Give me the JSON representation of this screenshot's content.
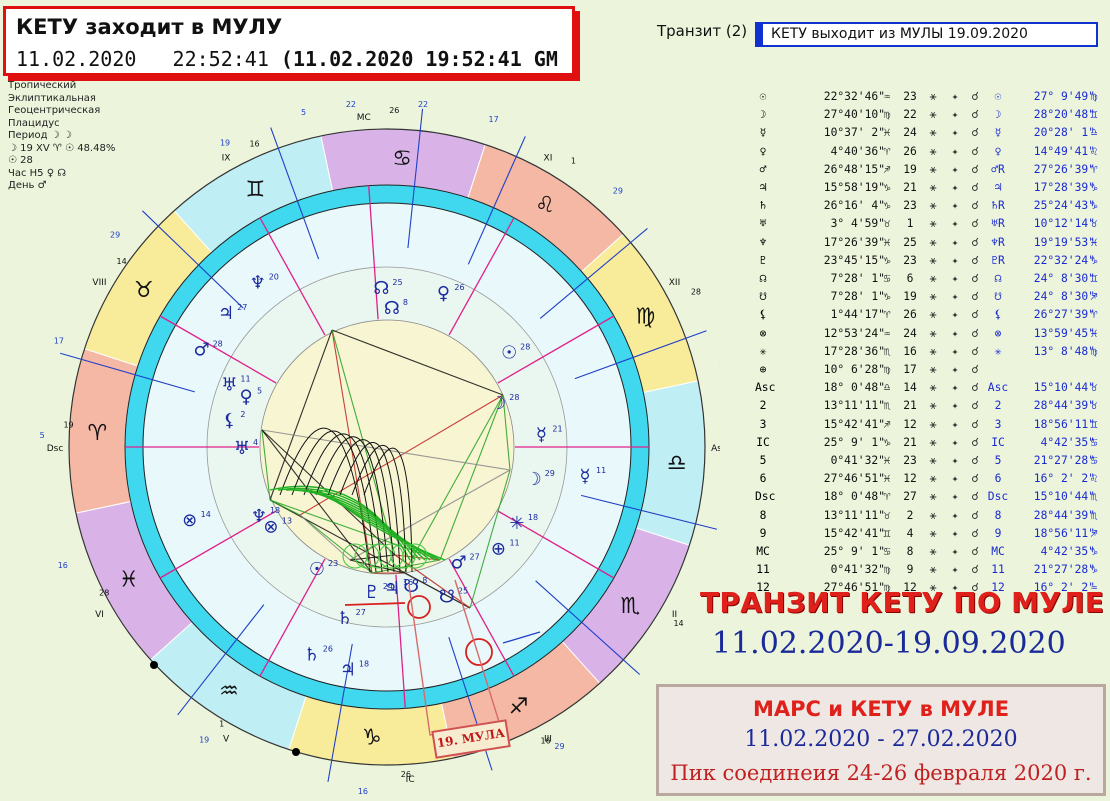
{
  "header": {
    "title": "КЕТУ заходит в МУЛУ",
    "date_local": "11.02.2020",
    "time_local": "22:52:41",
    "date_time_gmt": "(11.02.2020  19:52:41 GM"
  },
  "settings": [
    "Тропический",
    "Эклиптикальная",
    "Геоцентрическая",
    "Плацидус",
    "Период ☽ ☽",
    "☽ 19 XV ♈ ☉ 48.48%",
    "☉ 28",
    "Час H5 ♀ ☊",
    "День ♂"
  ],
  "transit": {
    "head": "Транзит (2)",
    "label": "КЕТУ выходит из МУЛЫ 19.09.2020"
  },
  "table": [
    {
      "pl": "☉",
      "pos": "22°32'46\"",
      "sg": "♒",
      "n": "23",
      "tpl": "☉",
      "tpos": "27° 9'49\"",
      "tsg": "♍"
    },
    {
      "pl": "☽",
      "pos": "27°40'10\"",
      "sg": "♍",
      "n": "22",
      "tpl": "☽",
      "tpos": "28°20'48\"",
      "tsg": "♊"
    },
    {
      "pl": "☿",
      "pos": "10°37' 2\"",
      "sg": "♓",
      "n": "24",
      "tpl": "☿",
      "tpos": "20°28' 1\"",
      "tsg": "♎"
    },
    {
      "pl": "♀",
      "pos": "4°40'36\"",
      "sg": "♈",
      "n": "26",
      "tpl": "♀",
      "tpos": "14°49'41\"",
      "tsg": "♌"
    },
    {
      "pl": "♂",
      "pos": "26°48'15\"",
      "sg": "♐",
      "n": "19",
      "tpl": "♂R",
      "tpos": "27°26'39\"",
      "tsg": "♈"
    },
    {
      "pl": "♃",
      "pos": "15°58'19\"",
      "sg": "♑",
      "n": "21",
      "tpl": "♃",
      "tpos": "17°28'39\"",
      "tsg": "♑"
    },
    {
      "pl": "♄",
      "pos": "26°16' 4\"",
      "sg": "♑",
      "n": "23",
      "tpl": "♄R",
      "tpos": "25°24'43\"",
      "tsg": "♑"
    },
    {
      "pl": "♅",
      "pos": "3° 4'59\"",
      "sg": "♉",
      "n": "1",
      "tpl": "♅R",
      "tpos": "10°12'14\"",
      "tsg": "♉"
    },
    {
      "pl": "♆",
      "pos": "17°26'39\"",
      "sg": "♓",
      "n": "25",
      "tpl": "♆R",
      "tpos": "19°19'53\"",
      "tsg": "♓"
    },
    {
      "pl": "♇",
      "pos": "23°45'15\"",
      "sg": "♑",
      "n": "23",
      "tpl": "♇R",
      "tpos": "22°32'24\"",
      "tsg": "♑"
    },
    {
      "pl": "☊",
      "pos": "7°28' 1\"",
      "sg": "♋",
      "n": "6",
      "tpl": "☊",
      "tpos": "24° 8'30\"",
      "tsg": "♊"
    },
    {
      "pl": "☋",
      "pos": "7°28' 1\"",
      "sg": "♑",
      "n": "19",
      "tpl": "☋",
      "tpos": "24° 8'30\"",
      "tsg": "♐"
    },
    {
      "pl": "⚸",
      "pos": "1°44'17\"",
      "sg": "♈",
      "n": "26",
      "tpl": "⚸",
      "tpos": "26°27'39\"",
      "tsg": "♈"
    },
    {
      "pl": "⊗",
      "pos": "12°53'24\"",
      "sg": "♒",
      "n": "24",
      "tpl": "⊗",
      "tpos": "13°59'45\"",
      "tsg": "♓"
    },
    {
      "pl": "✳",
      "pos": "17°28'36\"",
      "sg": "♏",
      "n": "16",
      "tpl": "✳",
      "tpos": "13° 8'48\"",
      "tsg": "♍"
    },
    {
      "pl": "⊕",
      "pos": "10° 6'28\"",
      "sg": "♍",
      "n": "17",
      "tpl": "",
      "tpos": "",
      "tsg": ""
    },
    {
      "pl": "Asc",
      "pos": "18° 0'48\"",
      "sg": "♎",
      "n": "14",
      "tpl": "Asc",
      "tpos": "15°10'44\"",
      "tsg": "♉"
    },
    {
      "pl": "2",
      "pos": "13°11'11\"",
      "sg": "♏",
      "n": "21",
      "tpl": "2",
      "tpos": "28°44'39\"",
      "tsg": "♉"
    },
    {
      "pl": "3",
      "pos": "15°42'41\"",
      "sg": "♐",
      "n": "12",
      "tpl": "3",
      "tpos": "18°56'11\"",
      "tsg": "♊"
    },
    {
      "pl": "IC",
      "pos": "25° 9' 1\"",
      "sg": "♑",
      "n": "21",
      "tpl": "IC",
      "tpos": "4°42'35\"",
      "tsg": "♋"
    },
    {
      "pl": "5",
      "pos": "0°41'32\"",
      "sg": "♓",
      "n": "23",
      "tpl": "5",
      "tpos": "21°27'28\"",
      "tsg": "♋"
    },
    {
      "pl": "6",
      "pos": "27°46'51\"",
      "sg": "♓",
      "n": "12",
      "tpl": "6",
      "tpos": "16° 2' 2\"",
      "tsg": "♌"
    },
    {
      "pl": "Dsc",
      "pos": "18° 0'48\"",
      "sg": "♈",
      "n": "27",
      "tpl": "Dsc",
      "tpos": "15°10'44\"",
      "tsg": "♏"
    },
    {
      "pl": "8",
      "pos": "13°11'11\"",
      "sg": "♉",
      "n": "2",
      "tpl": "8",
      "tpos": "28°44'39\"",
      "tsg": "♏"
    },
    {
      "pl": "9",
      "pos": "15°42'41\"",
      "sg": "♊",
      "n": "4",
      "tpl": "9",
      "tpos": "18°56'11\"",
      "tsg": "♐"
    },
    {
      "pl": "MC",
      "pos": "25° 9' 1\"",
      "sg": "♋",
      "n": "8",
      "tpl": "MC",
      "tpos": "4°42'35\"",
      "tsg": "♑"
    },
    {
      "pl": "11",
      "pos": "0°41'32\"",
      "sg": "♍",
      "n": "9",
      "tpl": "11",
      "tpos": "21°27'28\"",
      "tsg": "♑"
    },
    {
      "pl": "12",
      "pos": "27°46'51\"",
      "sg": "♍",
      "n": "12",
      "tpl": "12",
      "tpos": "16° 2' 2\"",
      "tsg": "♒"
    }
  ],
  "banner": {
    "title": "ТРАНЗИТ КЕТУ ПО МУЛЕ",
    "dates": "11.02.2020-19.09.2020"
  },
  "mars_box": {
    "title": "МАРС и КЕТУ в МУЛЕ",
    "dates": "11.02.2020 - 27.02.2020",
    "peak": "Пик соединеия 24-26 февраля 2020 г."
  },
  "mula_label": "19. МУЛА",
  "wheel": {
    "houses": [
      {
        "label": "MC",
        "deg": "26"
      },
      {
        "label": "XI",
        "deg": "1"
      },
      {
        "label": "XII",
        "deg": "28"
      },
      {
        "label": "Asc",
        "deg": "19"
      },
      {
        "label": "II",
        "deg": "14"
      },
      {
        "label": "III",
        "deg": "16"
      },
      {
        "label": "IC",
        "deg": "26"
      },
      {
        "label": "V",
        "deg": "1"
      },
      {
        "label": "VI",
        "deg": "28"
      },
      {
        "label": "Dsc",
        "deg": "19"
      },
      {
        "label": "VIII",
        "deg": "14"
      },
      {
        "label": "IX",
        "deg": "16"
      }
    ],
    "signs": [
      "♋",
      "♌",
      "♍",
      "♎",
      "♏",
      "♐",
      "♑",
      "♒",
      "♓",
      "♈",
      "♉",
      "♊"
    ],
    "outer_degs": [
      "22",
      "17",
      "5",
      "19",
      "29",
      "16",
      "29",
      "16",
      "19",
      "5",
      "17",
      "22",
      "29",
      "5",
      "16"
    ],
    "inner_planets": [
      {
        "g": "☊",
        "d": "25"
      },
      {
        "g": "♀",
        "d": "26"
      },
      {
        "g": "☊",
        "d": "8"
      },
      {
        "g": "☉",
        "d": "28"
      },
      {
        "g": "☽",
        "d": "28"
      },
      {
        "g": "☿",
        "d": "21"
      },
      {
        "g": "☽",
        "d": "29"
      },
      {
        "g": "✳",
        "d": "18"
      },
      {
        "g": "⊕",
        "d": "11"
      },
      {
        "g": "♂",
        "d": "27"
      },
      {
        "g": "☋",
        "d": "25"
      },
      {
        "g": "☋",
        "d": "8"
      },
      {
        "g": "♃",
        "d": "16"
      },
      {
        "g": "♇",
        "d": "24"
      },
      {
        "g": "♄",
        "d": "27"
      },
      {
        "g": "☉",
        "d": "23"
      },
      {
        "g": "⊗",
        "d": "13"
      },
      {
        "g": "♆",
        "d": "18"
      },
      {
        "g": "♀",
        "d": "5"
      },
      {
        "g": "⚸",
        "d": "2"
      },
      {
        "g": "♅",
        "d": "4"
      },
      {
        "g": "♅",
        "d": "11"
      },
      {
        "g": "♂",
        "d": "28"
      },
      {
        "g": "♃",
        "d": "27"
      },
      {
        "g": "♆",
        "d": "20"
      },
      {
        "g": "⊗",
        "d": "14"
      },
      {
        "g": "♄",
        "d": "26"
      },
      {
        "g": "♃",
        "d": "18"
      },
      {
        "g": "☿",
        "d": "11"
      }
    ]
  }
}
